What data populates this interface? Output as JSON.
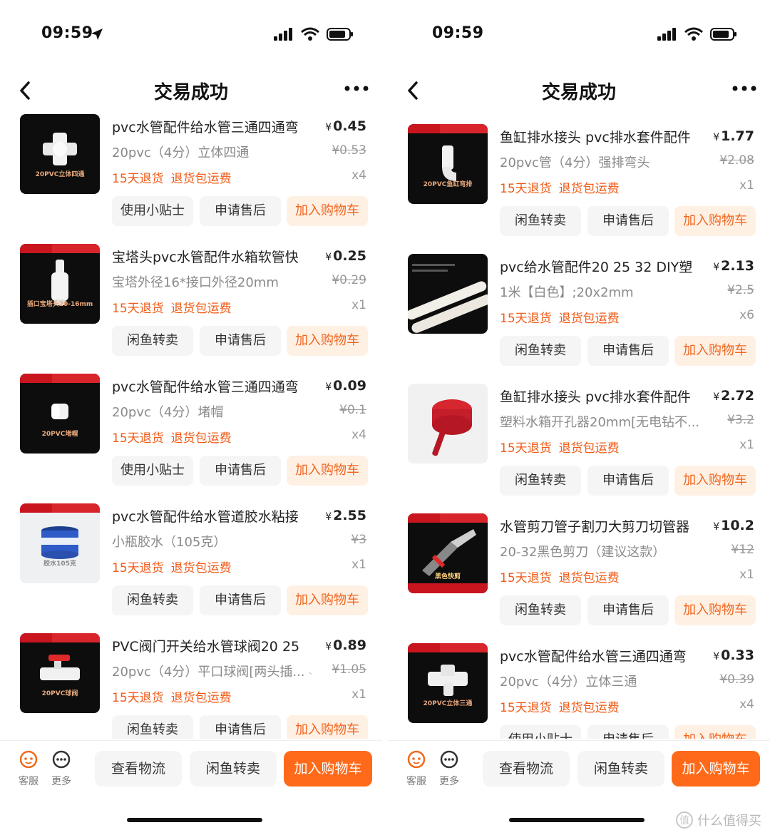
{
  "status_time": "09:59",
  "nav_title": "交易成功",
  "yen": "¥",
  "left_list": [
    {
      "title": "pvc水管配件给水管三通四通弯",
      "price": "0.45",
      "spec": "20pvc（4分）立体四通",
      "orig": "¥0.53",
      "qty": "x4",
      "caption": "20PVC立体四通",
      "buttons": [
        "使用小贴士",
        "申请售后",
        "加入购物车"
      ]
    },
    {
      "title": "宝塔头pvc水管配件水箱软管快",
      "price": "0.25",
      "spec": "宝塔外径16*接口外径20mm",
      "orig": "¥0.29",
      "qty": "x1",
      "caption": "插口宝塔头20-16mm",
      "buttons": [
        "闲鱼转卖",
        "申请售后",
        "加入购物车"
      ]
    },
    {
      "title": "pvc水管配件给水管三通四通弯",
      "price": "0.09",
      "spec": "20pvc（4分）堵帽",
      "orig": "¥0.1",
      "qty": "x4",
      "caption": "20PVC堵帽",
      "buttons": [
        "使用小贴士",
        "申请售后",
        "加入购物车"
      ]
    },
    {
      "title": "pvc水管配件给水管道胶水粘接",
      "price": "2.55",
      "spec": "小瓶胶水（105克）",
      "orig": "¥3",
      "qty": "x1",
      "caption": "胶水105克",
      "buttons": [
        "闲鱼转卖",
        "申请售后",
        "加入购物车"
      ]
    },
    {
      "title": "PVC阀门开关给水管球阀20 25",
      "price": "0.89",
      "spec": "20pvc（4分）平口球阀[两头插...",
      "orig": "¥1.05",
      "qty": "x1",
      "caption": "20PVC球阀",
      "buttons": [
        "闲鱼转卖",
        "申请售后",
        "加入购物车"
      ]
    }
  ],
  "right_list": [
    {
      "title": "鱼缸排水接头 pvc排水套件配件",
      "price": "1.77",
      "spec": "20pvc管（4分）强排弯头",
      "orig": "¥2.08",
      "qty": "x1",
      "caption": "20PVC鱼缸弯排",
      "buttons": [
        "闲鱼转卖",
        "申请售后",
        "加入购物车"
      ]
    },
    {
      "title": "pvc给水管配件20 25 32 DIY塑",
      "price": "2.13",
      "spec": "1米【白色】;20x2mm",
      "orig": "¥2.5",
      "qty": "x6",
      "caption": "",
      "buttons": [
        "闲鱼转卖",
        "申请售后",
        "加入购物车"
      ]
    },
    {
      "title": "鱼缸排水接头 pvc排水套件配件",
      "price": "2.72",
      "spec": "塑料水箱开孔器20mm[无电钻不...",
      "orig": "¥3.2",
      "qty": "x1",
      "caption": "",
      "buttons": [
        "闲鱼转卖",
        "申请售后",
        "加入购物车"
      ]
    },
    {
      "title": "水管剪刀管子割刀大剪刀切管器",
      "price": "10.2",
      "spec": "20-32黑色剪刀（建议这款）",
      "orig": "¥12",
      "qty": "x1",
      "caption": "黑色快剪",
      "buttons": [
        "闲鱼转卖",
        "申请售后",
        "加入购物车"
      ]
    },
    {
      "title": "pvc水管配件给水管三通四通弯",
      "price": "0.33",
      "spec": "20pvc（4分）立体三通",
      "orig": "¥0.39",
      "qty": "x4",
      "caption": "20PVC立体三通",
      "buttons": [
        "使用小贴士",
        "申请售后",
        "加入购物车"
      ]
    }
  ],
  "bottom": {
    "kefu": "客服",
    "more": "更多",
    "logistics": "查看物流",
    "resell": "闲鱼转卖",
    "cart": "加入购物车"
  },
  "watermark": "什么值得买",
  "colors": {
    "accent": "#ff6a1a",
    "policy": "#f05a16",
    "cart_tint": "#fff0e4"
  }
}
